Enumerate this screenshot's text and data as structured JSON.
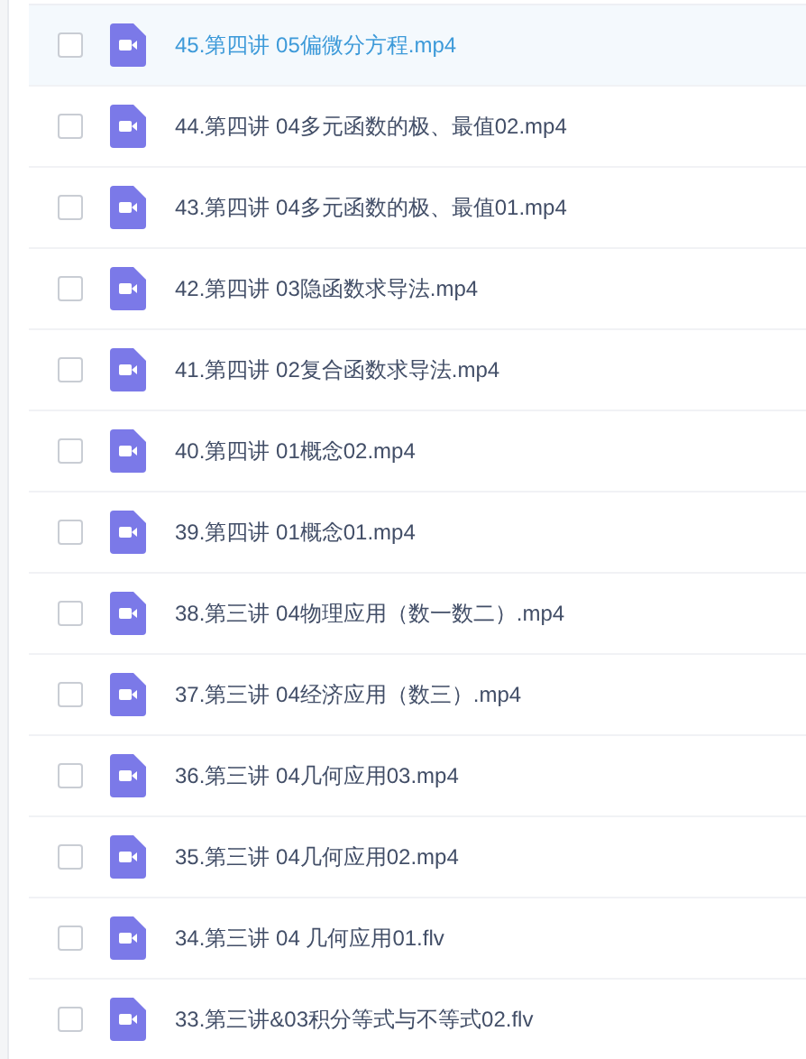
{
  "files": [
    {
      "name": "45.第四讲 05偏微分方程.mp4",
      "selected": true,
      "checked": false
    },
    {
      "name": "44.第四讲 04多元函数的极、最值02.mp4",
      "selected": false,
      "checked": false
    },
    {
      "name": "43.第四讲 04多元函数的极、最值01.mp4",
      "selected": false,
      "checked": false
    },
    {
      "name": "42.第四讲 03隐函数求导法.mp4",
      "selected": false,
      "checked": false
    },
    {
      "name": "41.第四讲 02复合函数求导法.mp4",
      "selected": false,
      "checked": false
    },
    {
      "name": "40.第四讲 01概念02.mp4",
      "selected": false,
      "checked": false
    },
    {
      "name": "39.第四讲 01概念01.mp4",
      "selected": false,
      "checked": false
    },
    {
      "name": "38.第三讲 04物理应用（数一数二）.mp4",
      "selected": false,
      "checked": false
    },
    {
      "name": "37.第三讲 04经济应用（数三）.mp4",
      "selected": false,
      "checked": false
    },
    {
      "name": "36.第三讲 04几何应用03.mp4",
      "selected": false,
      "checked": false
    },
    {
      "name": "35.第三讲 04几何应用02.mp4",
      "selected": false,
      "checked": false
    },
    {
      "name": "34.第三讲 04 几何应用01.flv",
      "selected": false,
      "checked": false
    },
    {
      "name": "33.第三讲&03积分等式与不等式02.flv",
      "selected": false,
      "checked": false
    }
  ]
}
